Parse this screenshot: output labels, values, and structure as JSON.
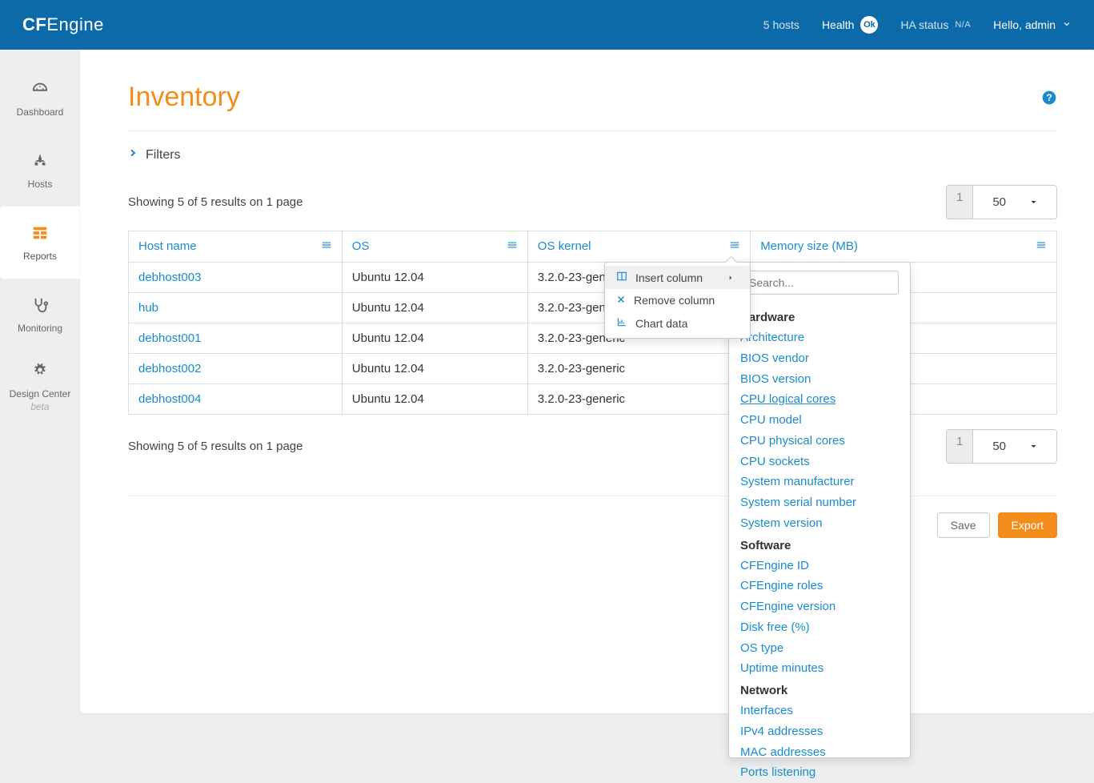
{
  "header": {
    "logo_left": "CF",
    "logo_right": "Engine",
    "hosts_label": "5 hosts",
    "health_label": "Health",
    "health_badge": "Ok",
    "ha_label": "HA status",
    "ha_value": "N/A",
    "greeting": "Hello, admin"
  },
  "sidebar": {
    "items": [
      {
        "label": "Dashboard",
        "icon": "dashboard"
      },
      {
        "label": "Hosts",
        "icon": "hosts"
      },
      {
        "label": "Reports",
        "icon": "reports",
        "active": true
      },
      {
        "label": "Monitoring",
        "icon": "monitoring"
      },
      {
        "label": "Design Center",
        "icon": "design",
        "sub": "beta"
      }
    ]
  },
  "page": {
    "title": "Inventory",
    "filters_label": "Filters",
    "results_text": "Showing 5 of 5 results on 1 page",
    "page_num": "1",
    "page_size": "50"
  },
  "table": {
    "cols": [
      "Host name",
      "OS",
      "OS kernel",
      "Memory size (MB)"
    ],
    "rows": [
      {
        "host": "debhost003",
        "os": "Ubuntu 12.04",
        "kernel": "3.2.0-23-generic",
        "mem": ""
      },
      {
        "host": "hub",
        "os": "Ubuntu 12.04",
        "kernel": "3.2.0-23-generic",
        "mem": ""
      },
      {
        "host": "debhost001",
        "os": "Ubuntu 12.04",
        "kernel": "3.2.0-23-generic",
        "mem": ""
      },
      {
        "host": "debhost002",
        "os": "Ubuntu 12.04",
        "kernel": "3.2.0-23-generic",
        "mem": ""
      },
      {
        "host": "debhost004",
        "os": "Ubuntu 12.04",
        "kernel": "3.2.0-23-generic",
        "mem": ""
      }
    ]
  },
  "ctx": {
    "insert": "Insert column",
    "remove": "Remove column",
    "chart": "Chart data"
  },
  "submenu": {
    "search_placeholder": "Search...",
    "groups": [
      {
        "title": "Hardware",
        "items": [
          "Architecture",
          "BIOS vendor",
          "BIOS version",
          "CPU logical cores",
          "CPU model",
          "CPU physical cores",
          "CPU sockets",
          "System manufacturer",
          "System serial number",
          "System version"
        ]
      },
      {
        "title": "Software",
        "items": [
          "CFEngine ID",
          "CFEngine roles",
          "CFEngine version",
          "Disk free (%)",
          "OS type",
          "Uptime minutes"
        ]
      },
      {
        "title": "Network",
        "items": [
          "Interfaces",
          "IPv4 addresses",
          "MAC addresses",
          "Ports listening"
        ]
      }
    ]
  },
  "buttons": {
    "save": "Save",
    "export": "Export"
  }
}
